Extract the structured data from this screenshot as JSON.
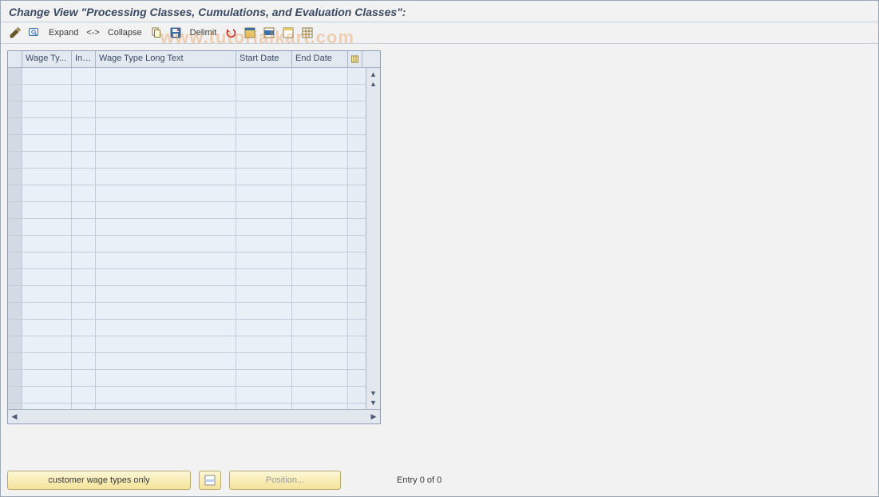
{
  "title": "Change View \"Processing Classes, Cumulations, and Evaluation Classes\":",
  "toolbar": {
    "expand_label": "Expand",
    "arrow_label": "<->",
    "collapse_label": "Collapse",
    "delimit_label": "Delimit",
    "icons": {
      "change": "change-display-icon",
      "other_entry": "other-entry-icon",
      "copy": "copy-icon",
      "save": "save-icon",
      "undo": "undo-icon",
      "select_all": "select-all-icon",
      "select_block": "select-block-icon",
      "deselect": "deselect-all-icon",
      "print": "print-icon"
    }
  },
  "grid": {
    "columns": {
      "wage_type": "Wage Ty...",
      "info": "Inf...",
      "wage_type_long": "Wage Type Long Text",
      "start_date": "Start Date",
      "end_date": "End Date"
    },
    "rows_visible": 21
  },
  "footer": {
    "cust_btn": "customer wage types only",
    "position_btn": "Position...",
    "status": "Entry 0 of 0"
  },
  "watermark": "www.tutorialkart.com"
}
